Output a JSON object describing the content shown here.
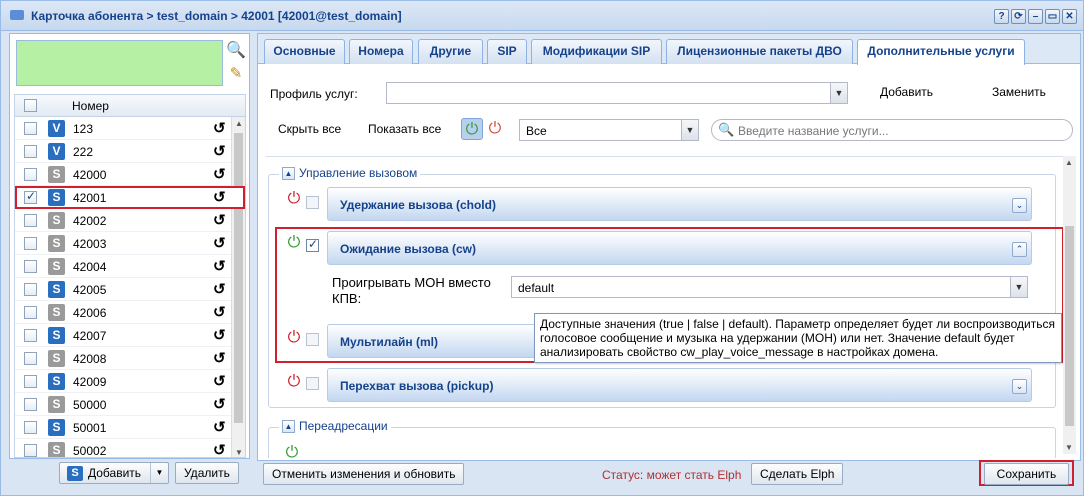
{
  "window": {
    "title": "Карточка абонента > test_domain > 42001 [42001@test_domain]",
    "buttons": [
      "?",
      "⟳",
      "▭",
      "▭",
      "✕"
    ]
  },
  "left": {
    "header_col": "Номер",
    "rows": [
      {
        "type": "V",
        "number": "123",
        "checked": false
      },
      {
        "type": "V",
        "number": "222",
        "checked": false
      },
      {
        "type": "G",
        "number": "42000",
        "checked": false
      },
      {
        "type": "S",
        "number": "42001",
        "checked": true
      },
      {
        "type": "G",
        "number": "42002",
        "checked": false
      },
      {
        "type": "G",
        "number": "42003",
        "checked": false
      },
      {
        "type": "G",
        "number": "42004",
        "checked": false
      },
      {
        "type": "S",
        "number": "42005",
        "checked": false
      },
      {
        "type": "G",
        "number": "42006",
        "checked": false
      },
      {
        "type": "S",
        "number": "42007",
        "checked": false
      },
      {
        "type": "G",
        "number": "42008",
        "checked": false
      },
      {
        "type": "S",
        "number": "42009",
        "checked": false
      },
      {
        "type": "G",
        "number": "50000",
        "checked": false
      },
      {
        "type": "S",
        "number": "50001",
        "checked": false
      },
      {
        "type": "G",
        "number": "50002",
        "checked": false
      }
    ],
    "add_label": "Добавить",
    "delete_label": "Удалить",
    "type_icon_letter": "S"
  },
  "tabs": [
    "Основные",
    "Номера",
    "Другие",
    "SIP",
    "Модификации SIP",
    "Лицензионные пакеты ДВО",
    "Дополнительные услуги"
  ],
  "toolbar": {
    "profile_label": "Профиль услуг:",
    "profile_value": "",
    "add_label": "Добавить",
    "replace_label": "Заменить",
    "hide_all": "Скрыть все",
    "show_all": "Показать все",
    "filter_value": "Все",
    "search_placeholder": "Введите название услуги..."
  },
  "groups": {
    "call_control": "Управление вызовом",
    "forwarding": "Переадресации"
  },
  "services": {
    "chold": "Удержание вызова (chold)",
    "cw": "Ожидание вызова (cw)",
    "ml": "Мультилайн (ml)",
    "pickup": "Перехват вызова (pickup)"
  },
  "cw_param": {
    "label_line1": "Проигрывать МОН вместо",
    "label_line2": "КПВ:",
    "value": "default"
  },
  "tooltip": {
    "line1": "Доступные значения (true | false | default). Параметр определяет будет ли воспроизводиться",
    "line2": "голосовое сообщение и музыка на удержании (МОН) или нет. Значение default будет",
    "line3": "анализировать свойство cw_play_voice_message в настройках домена."
  },
  "bottom": {
    "cancel_label": "Отменить изменения и обновить",
    "status": "Статус: может стать Elph",
    "make_elph": "Сделать Elph",
    "save": "Сохранить"
  },
  "colors": {
    "accent": "#15428b",
    "highlight_red": "#d0202e",
    "filter_green": "#b5f0a5"
  }
}
